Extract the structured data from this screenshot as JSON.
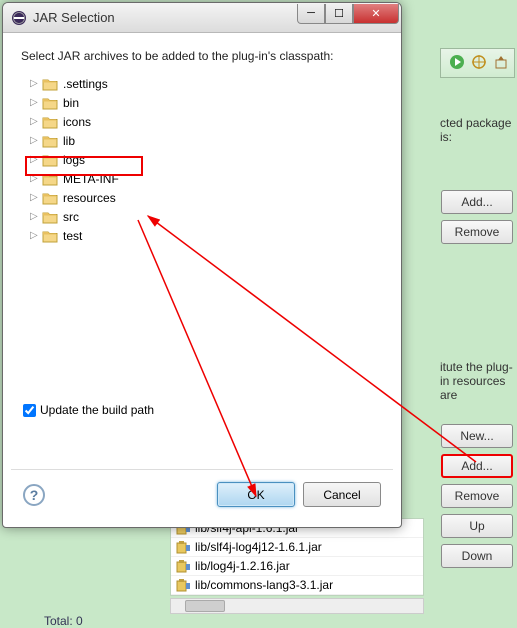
{
  "dialog": {
    "title": "JAR Selection",
    "instruction": "Select JAR archives to be added to the plug-in's classpath:",
    "folders": [
      {
        "name": ".settings",
        "selected": false
      },
      {
        "name": "bin",
        "selected": false
      },
      {
        "name": "icons",
        "selected": false
      },
      {
        "name": "lib",
        "selected": false
      },
      {
        "name": "logs",
        "selected": false
      },
      {
        "name": "META-INF",
        "selected": false
      },
      {
        "name": "resources",
        "selected": true
      },
      {
        "name": "src",
        "selected": false
      },
      {
        "name": "test",
        "selected": false
      }
    ],
    "update_label": "Update the build path",
    "update_checked": true,
    "ok_label": "OK",
    "cancel_label": "Cancel"
  },
  "background": {
    "text_top": "cted package is:",
    "text_mid": "itute the plug-in resources are",
    "btns_top": {
      "add": "Add...",
      "remove": "Remove"
    },
    "btns_bottom": {
      "new": "New...",
      "add": "Add...",
      "remove": "Remove",
      "up": "Up",
      "down": "Down"
    },
    "jar_list": [
      "lib/slf4j-api-1.6.1.jar",
      "lib/slf4j-log4j12-1.6.1.jar",
      "lib/log4j-1.2.16.jar",
      "lib/commons-lang3-3.1.jar"
    ],
    "total_label": "Total: 0"
  }
}
